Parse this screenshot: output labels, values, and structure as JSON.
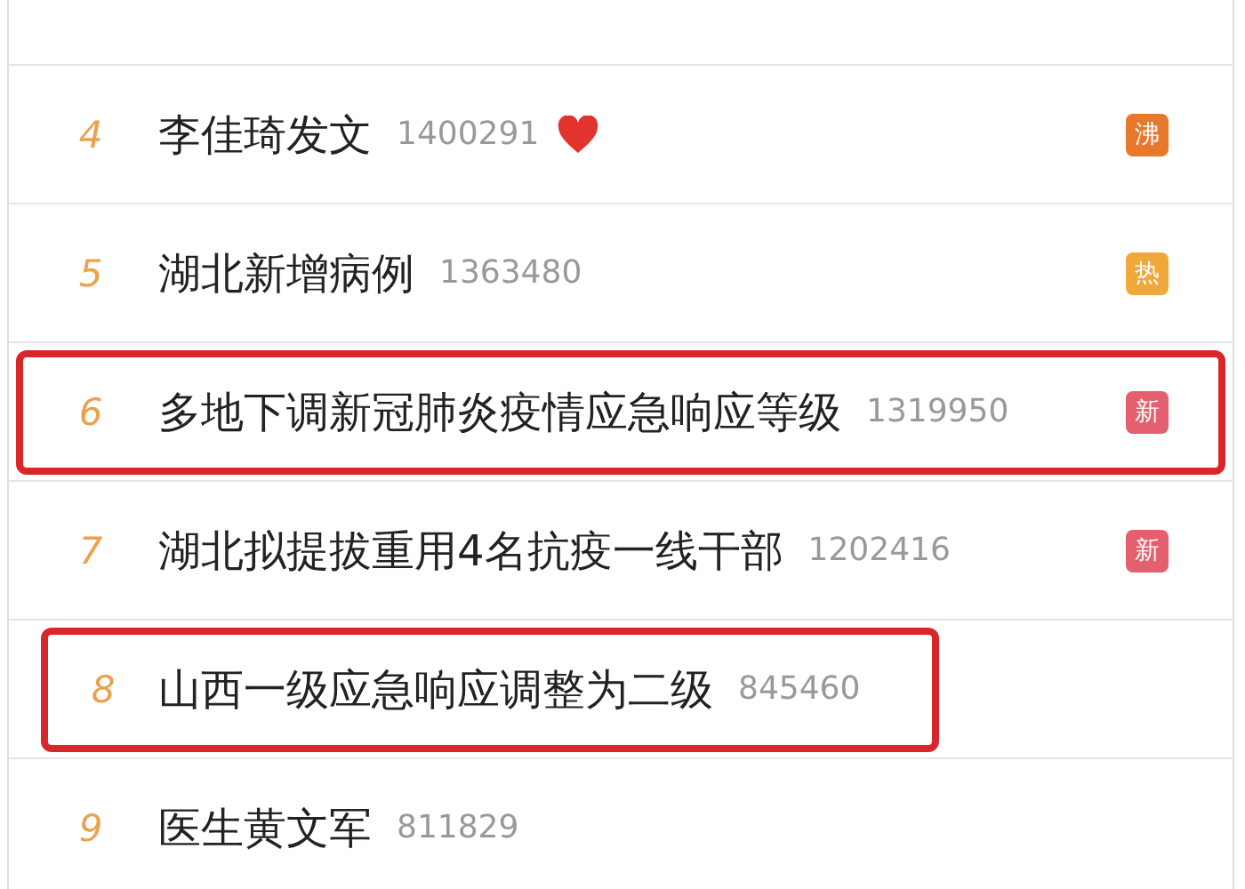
{
  "hot_list": [
    {
      "rank": "4",
      "title": "李佳琦发文",
      "count": "1400291",
      "heart": true,
      "badge": {
        "label": "沸",
        "color": "#e8782c"
      },
      "highlighted": false
    },
    {
      "rank": "5",
      "title": "湖北新增病例",
      "count": "1363480",
      "heart": false,
      "badge": {
        "label": "热",
        "color": "#f0a83a"
      },
      "highlighted": false
    },
    {
      "rank": "6",
      "title": "多地下调新冠肺炎疫情应急响应等级",
      "count": "1319950",
      "heart": false,
      "badge": {
        "label": "新",
        "color": "#e5606e"
      },
      "highlighted": true
    },
    {
      "rank": "7",
      "title": "湖北拟提拔重用4名抗疫一线干部",
      "count": "1202416",
      "heart": false,
      "badge": {
        "label": "新",
        "color": "#e5606e"
      },
      "highlighted": false
    },
    {
      "rank": "8",
      "title": "山西一级应急响应调整为二级",
      "count": "845460",
      "heart": false,
      "highlighted": true
    },
    {
      "rank": "9",
      "title": "医生黄文军",
      "count": "811829",
      "heart": false,
      "highlighted": false
    }
  ]
}
